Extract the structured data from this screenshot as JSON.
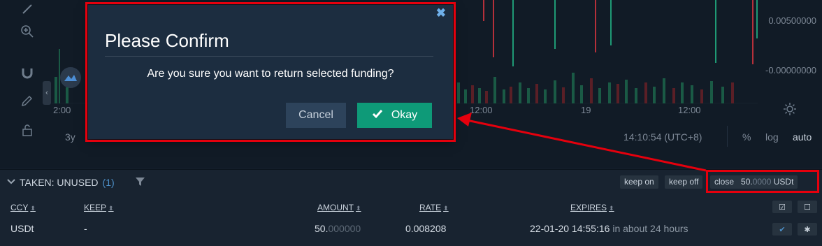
{
  "chart": {
    "y_labels": [
      "0.00500000",
      "-0.00000000"
    ],
    "x_labels": [
      "2:00",
      "12:00",
      "19",
      "12:00"
    ],
    "range_button": "3y",
    "clock": "14:10:54 (UTC+8)",
    "scale_percent": "%",
    "scale_log": "log",
    "scale_auto": "auto"
  },
  "panel": {
    "title": "TAKEN: UNUSED",
    "count": "(1)",
    "buttons": {
      "keep_on": "keep on",
      "keep_off": "keep off",
      "close": "close",
      "close_amount_main": "50.",
      "close_amount_dim": "0000",
      "close_currency": "USDt"
    },
    "columns": {
      "ccy": "CCY",
      "keep": "KEEP",
      "amount": "AMOUNT",
      "rate": "RATE",
      "expires": "EXPIRES"
    },
    "rows": [
      {
        "ccy": "USDt",
        "keep": "-",
        "amount_main": "50.",
        "amount_dim": "000000",
        "rate": "0.008208",
        "expires": "22-01-20 14:55:16",
        "expires_rel": "in about 24 hours"
      }
    ]
  },
  "modal": {
    "title": "Please Confirm",
    "message": "Are you sure you want to return selected funding?",
    "cancel_label": "Cancel",
    "okay_label": "Okay"
  },
  "colors": {
    "okay": "#0e9a78",
    "cancel": "#2d435b",
    "modal_bg": "#1c2d40",
    "annotation": "#e5000d"
  }
}
